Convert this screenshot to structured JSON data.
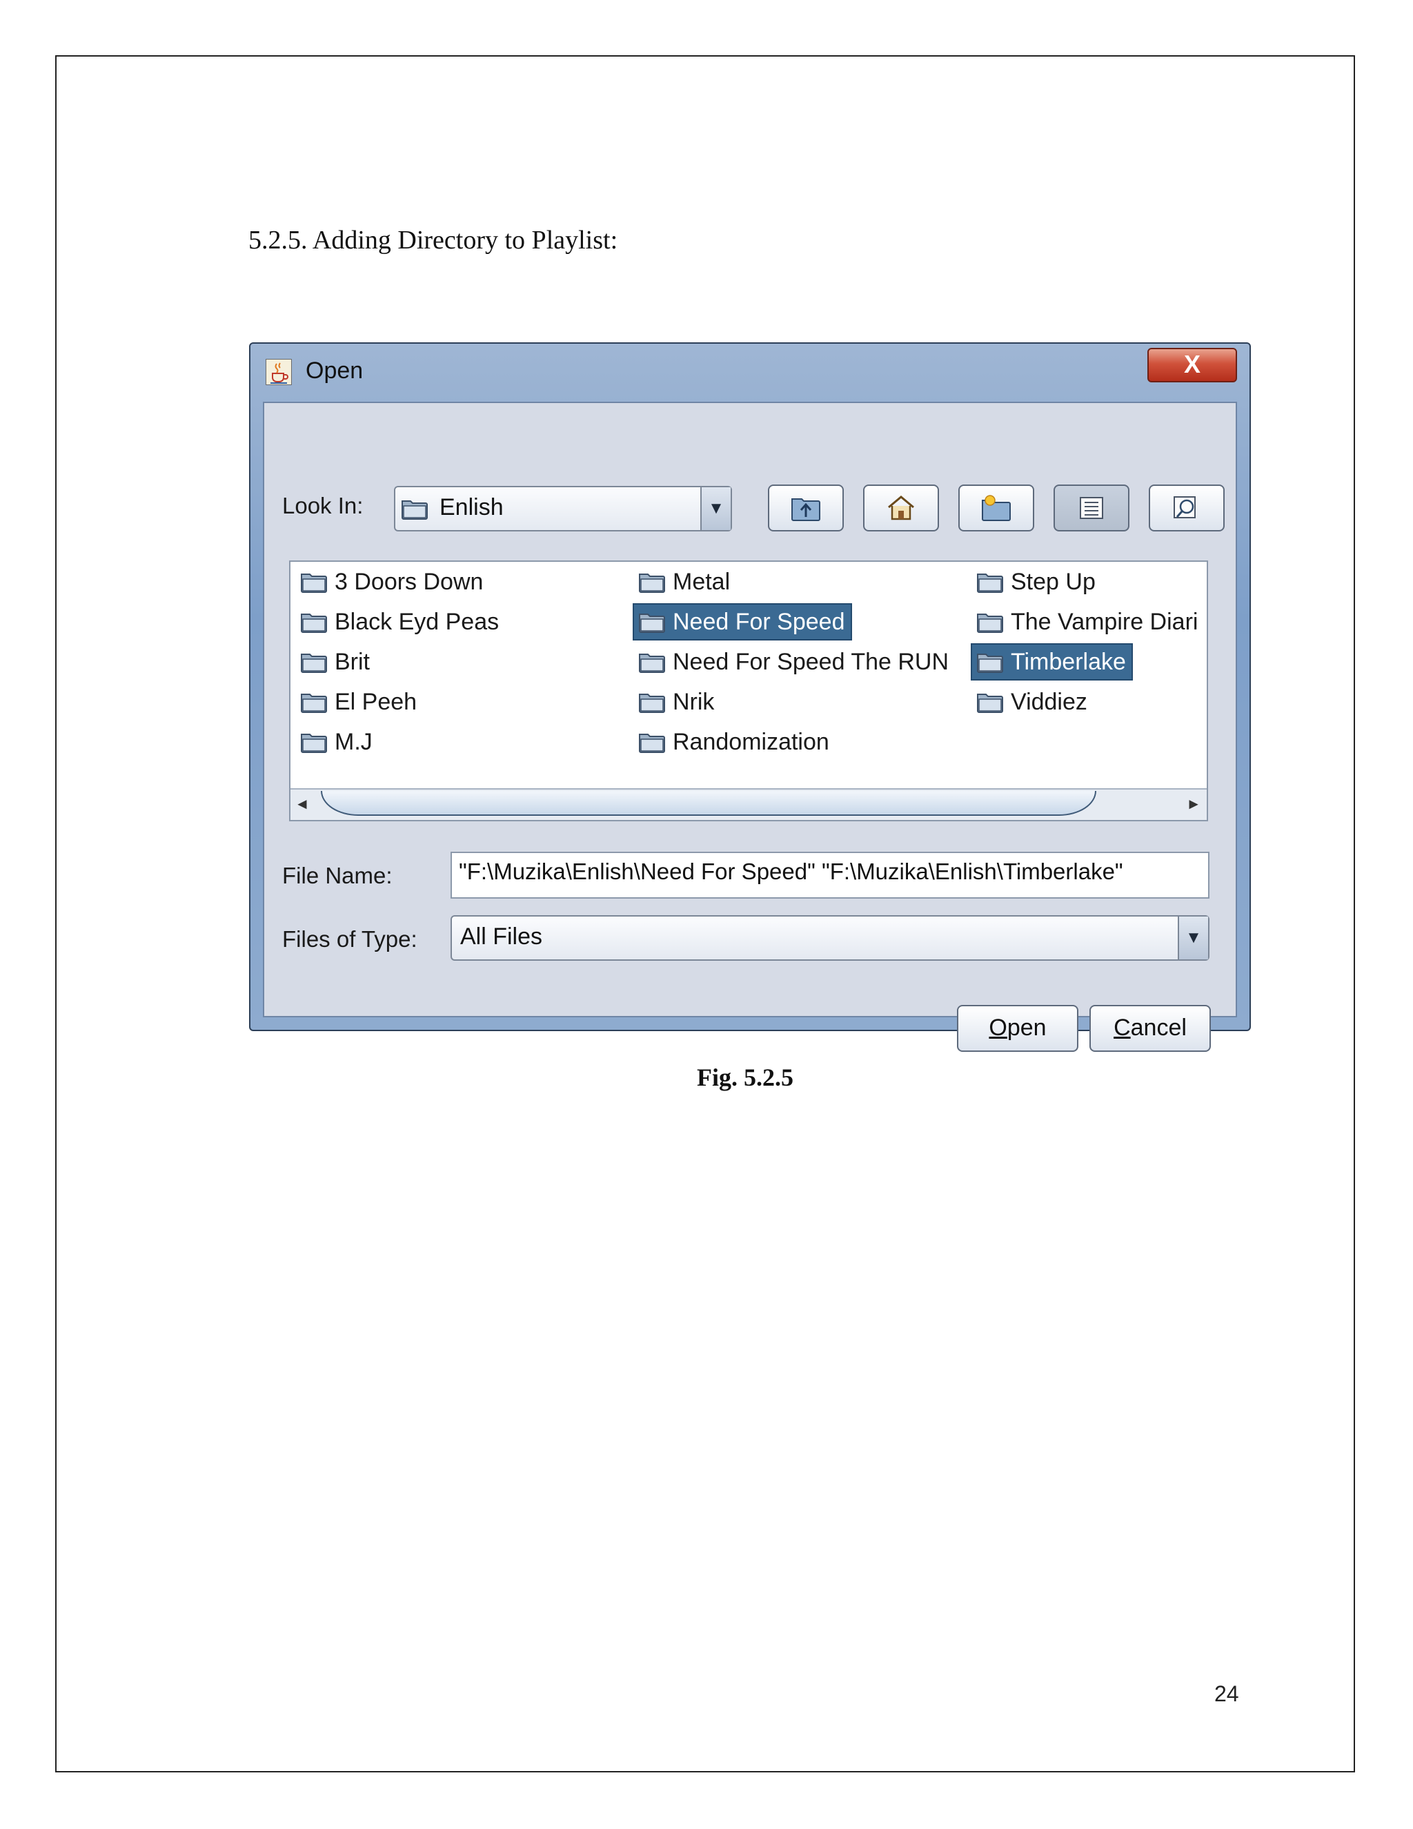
{
  "document": {
    "section_heading": "5.2.5.   Adding Directory to Playlist:",
    "figure_caption": "Fig. 5.2.5",
    "page_number": "24"
  },
  "dialog": {
    "title": "Open",
    "close_glyph": "X",
    "look_in_label": "Look In:",
    "look_in_value": "Enlish",
    "toolbar_icons": [
      "up-folder-icon",
      "home-icon",
      "new-folder-icon",
      "list-view-icon",
      "details-view-icon"
    ],
    "files": [
      {
        "name": "3 Doors Down",
        "selected": false
      },
      {
        "name": "Black Eyd Peas",
        "selected": false
      },
      {
        "name": "Brit",
        "selected": false
      },
      {
        "name": "El Peeh",
        "selected": false
      },
      {
        "name": "M.J",
        "selected": false
      },
      {
        "name": "Metal",
        "selected": false
      },
      {
        "name": "Need For Speed",
        "selected": true
      },
      {
        "name": "Need For Speed The RUN",
        "selected": false
      },
      {
        "name": "Nrik",
        "selected": false
      },
      {
        "name": "Randomization",
        "selected": false
      },
      {
        "name": "Step Up",
        "selected": false
      },
      {
        "name": "The Vampire Diari",
        "selected": false
      },
      {
        "name": "Timberlake",
        "selected": true
      },
      {
        "name": "Viddiez",
        "selected": false
      }
    ],
    "file_name_label": "File Name:",
    "file_name_value": "\"F:\\Muzika\\Enlish\\Need For Speed\" \"F:\\Muzika\\Enlish\\Timberlake\"",
    "files_of_type_label": "Files of Type:",
    "files_of_type_value": "All Files",
    "open_button": {
      "mnemonic": "O",
      "rest": "pen"
    },
    "cancel_button": {
      "mnemonic": "C",
      "rest": "ancel"
    },
    "selection_color": "#3b6a93"
  }
}
